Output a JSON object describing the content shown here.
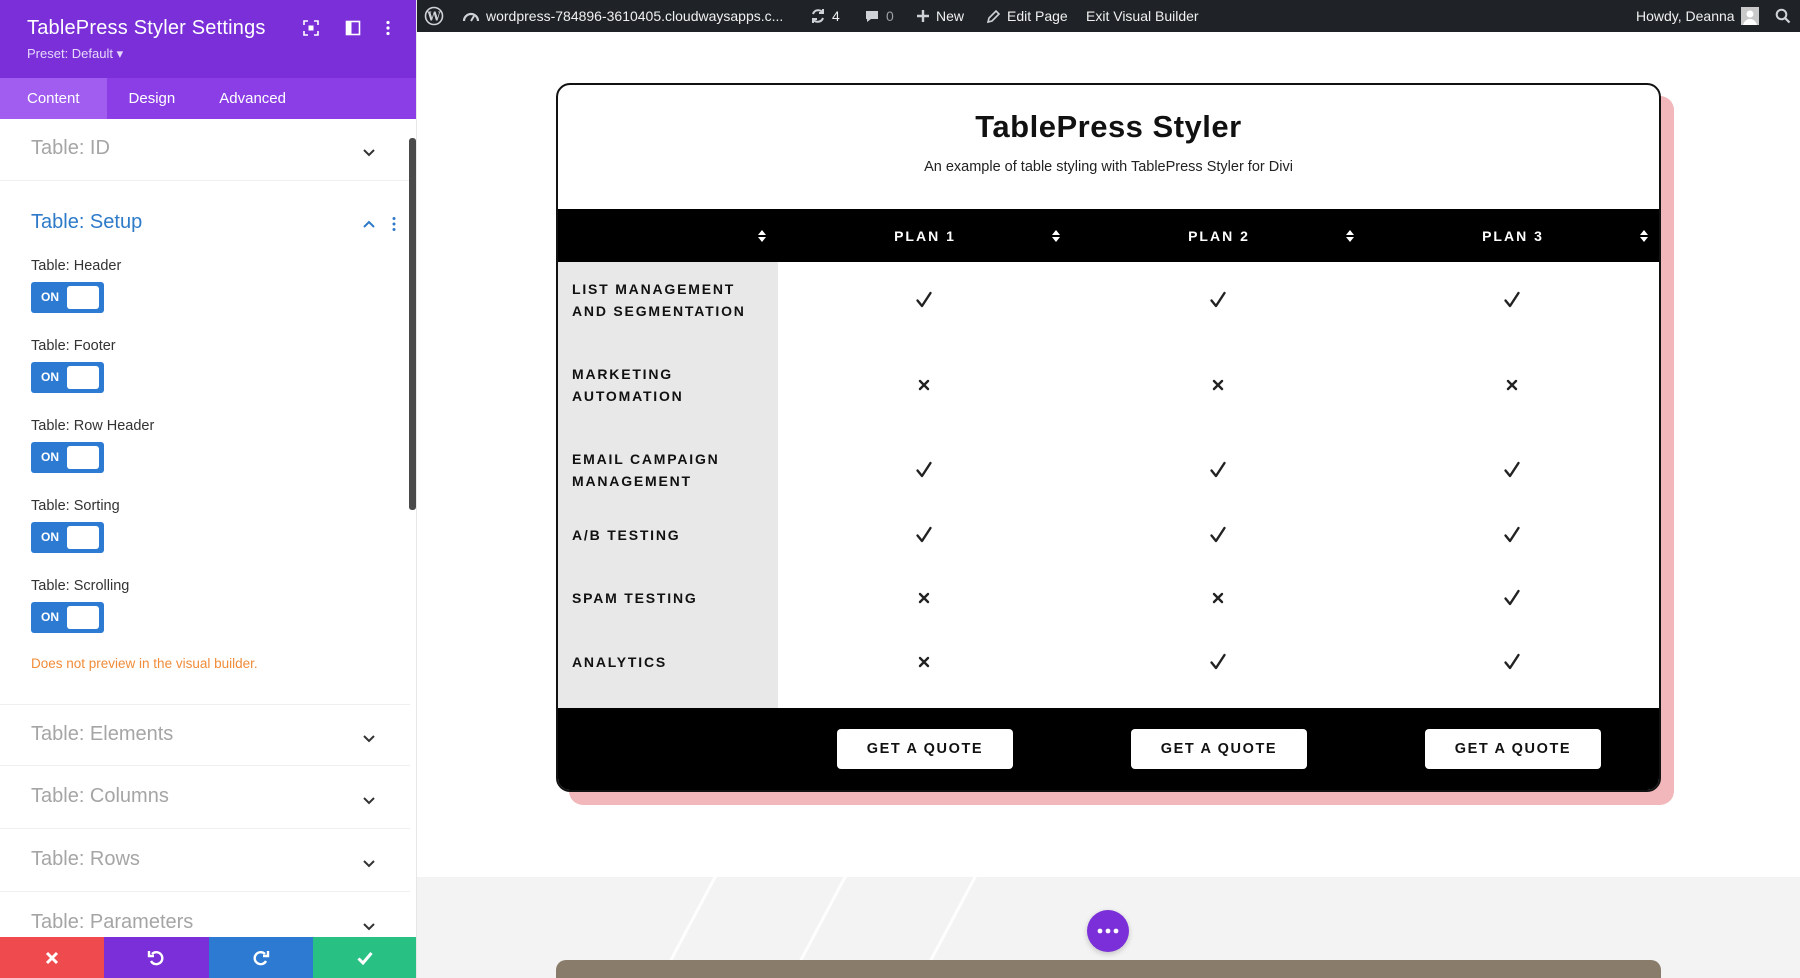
{
  "panel": {
    "title": "TablePress Styler Settings",
    "preset": "Preset: Default ▾",
    "tabs": [
      {
        "label": "Content"
      },
      {
        "label": "Design"
      },
      {
        "label": "Advanced"
      }
    ],
    "sections": {
      "table_id": "Table: ID",
      "table_setup": "Table: Setup",
      "table_elements": "Table: Elements",
      "table_columns": "Table: Columns",
      "table_rows": "Table: Rows",
      "table_parameters": "Table: Parameters"
    },
    "fields": [
      {
        "label": "Table: Header",
        "state": "ON"
      },
      {
        "label": "Table: Footer",
        "state": "ON"
      },
      {
        "label": "Table: Row Header",
        "state": "ON"
      },
      {
        "label": "Table: Sorting",
        "state": "ON"
      },
      {
        "label": "Table: Scrolling",
        "state": "ON"
      }
    ],
    "warning": "Does not preview in the visual builder.",
    "accent_color": "#7b2fd8"
  },
  "adminbar": {
    "site": "wordpress-784896-3610405.cloudwaysapps.c...",
    "updates": "4",
    "comments": "0",
    "new": "New",
    "edit_page": "Edit Page",
    "exit_builder": "Exit Visual Builder",
    "greeting": "Howdy, Deanna"
  },
  "table": {
    "title": "TablePress Styler",
    "subtitle": "An example of table styling with TablePress Styler for Divi",
    "columns": [
      "",
      "PLAN 1",
      "PLAN 2",
      "PLAN 3"
    ],
    "rows": [
      {
        "label": "LIST MANAGEMENT AND SEGMENTATION",
        "line1": "LIST MANAGEMENT",
        "line2": "AND SEGMENTATION",
        "values": [
          "check",
          "check",
          "check"
        ]
      },
      {
        "label": "MARKETING AUTOMATION",
        "line1": "MARKETING",
        "line2": "AUTOMATION",
        "values": [
          "cross",
          "cross",
          "cross"
        ]
      },
      {
        "label": "EMAIL CAMPAIGN MANAGEMENT",
        "line1": "EMAIL CAMPAIGN",
        "line2": "MANAGEMENT",
        "values": [
          "check",
          "check",
          "check"
        ]
      },
      {
        "label": "A/B TESTING",
        "line1": "A/B TESTING",
        "line2": "",
        "values": [
          "check",
          "check",
          "check"
        ]
      },
      {
        "label": "SPAM TESTING",
        "line1": "SPAM TESTING",
        "line2": "",
        "values": [
          "cross",
          "cross",
          "check"
        ]
      },
      {
        "label": "ANALYTICS",
        "line1": "ANALYTICS",
        "line2": "",
        "values": [
          "cross",
          "check",
          "check"
        ]
      }
    ],
    "footer_button": "GET A QUOTE",
    "shadow_color": "#f1b7ba"
  }
}
